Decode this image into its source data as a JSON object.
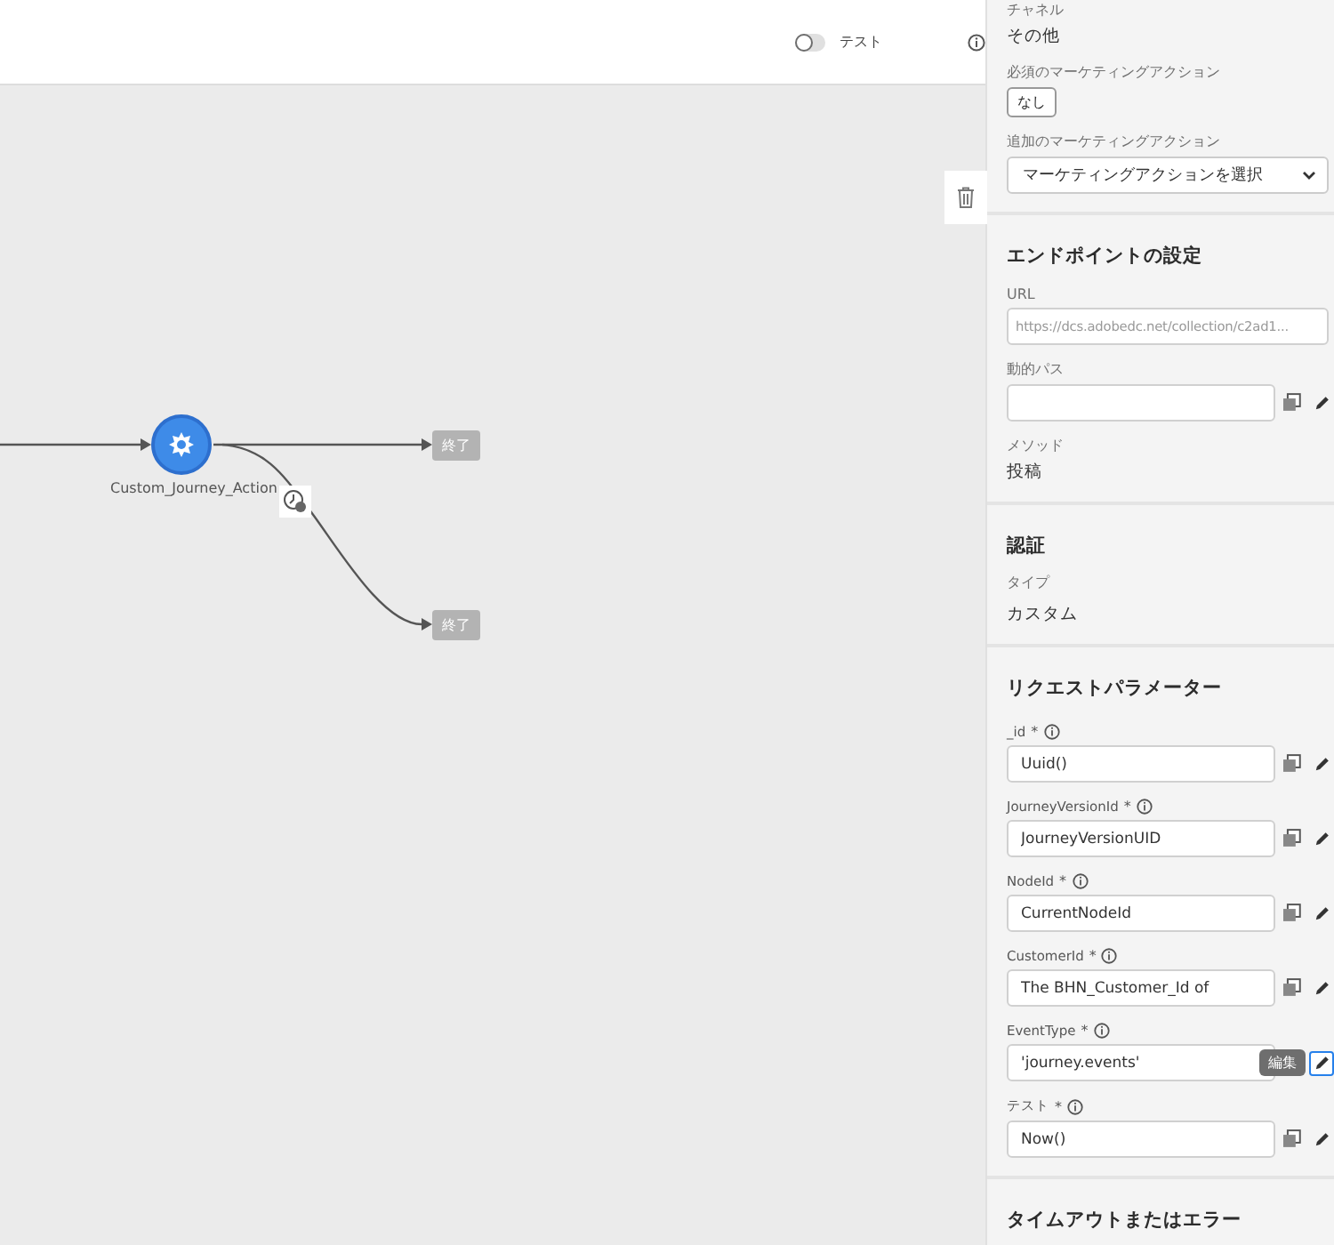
{
  "top_bar": {
    "test_toggle": {
      "label": "テスト",
      "on": false
    }
  },
  "canvas": {
    "nodes": [
      {
        "kind": "action",
        "label": "Custom_Journey_Action"
      },
      {
        "kind": "end",
        "label": "終了"
      },
      {
        "kind": "end",
        "label": "終了"
      }
    ]
  },
  "panel": {
    "channel": {
      "label": "チャネル",
      "value": "その他"
    },
    "required_actions": {
      "label": "必須のマーケティングアクション",
      "tag": "なし"
    },
    "additional_actions": {
      "label": "追加のマーケティングアクション",
      "placeholder": "マーケティングアクションを選択"
    },
    "endpoint": {
      "title": "エンドポイントの設定",
      "url_label": "URL",
      "url_placeholder": "https://dcs.adobedc.net/collection/c2ad1...",
      "path_label": "動的パス",
      "method_label": "メソッド",
      "method_value": "投稿"
    },
    "auth": {
      "title": "認証",
      "type_label": "タイプ",
      "type_value": "カスタム"
    },
    "request_params": {
      "title": "リクエストパラメーター",
      "params": [
        {
          "name": "_id",
          "mark": "*",
          "value": "Uuid()",
          "edit_focused": false
        },
        {
          "name": "JourneyVersionId",
          "mark": "*",
          "value": "JourneyVersionUID",
          "edit_focused": false
        },
        {
          "name": "NodeId",
          "mark": "*",
          "value": "CurrentNodeId",
          "edit_focused": false
        },
        {
          "name": "CustomerId",
          "mark": "*",
          "value": "The BHN_Customer_Id of",
          "edit_focused": false
        },
        {
          "name": "EventType",
          "mark": "*",
          "value": "'journey.events'",
          "edit_focused": true,
          "tooltip": "編集"
        },
        {
          "name": "テスト",
          "mark": "*",
          "value": "Now()",
          "edit_focused": false
        }
      ]
    },
    "timeout": {
      "title": "タイムアウトまたはエラー"
    }
  }
}
